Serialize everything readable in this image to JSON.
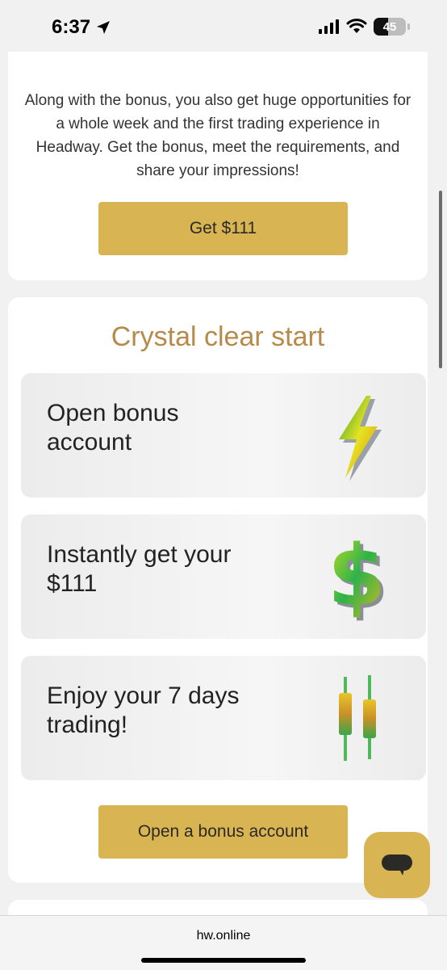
{
  "status_bar": {
    "time": "6:37",
    "battery": "45",
    "icons": [
      "location-arrow-icon",
      "signal-icon",
      "wifi-icon",
      "battery-icon"
    ]
  },
  "bonus_card": {
    "description": "Along with the bonus, you also get huge opportunities for a whole week and the first trading experience in Headway. Get the bonus, meet the requirements, and share your impressions!",
    "button_label": "Get $111"
  },
  "steps_section": {
    "title": "Crystal clear start",
    "steps": [
      {
        "label": "Open bonus account",
        "icon": "lightning-bolt-icon"
      },
      {
        "label": "Instantly get your $111",
        "icon": "dollar-sign-icon"
      },
      {
        "label": "Enjoy your 7 days trading!",
        "icon": "candlestick-icon"
      }
    ],
    "button_label": "Open a bonus account"
  },
  "chat": {
    "icon": "chat-bubble-icon"
  },
  "browser": {
    "url": "hw.online"
  },
  "colors": {
    "accent": "#d9b453",
    "title": "#b68a48",
    "background": "#f1f1f1"
  }
}
